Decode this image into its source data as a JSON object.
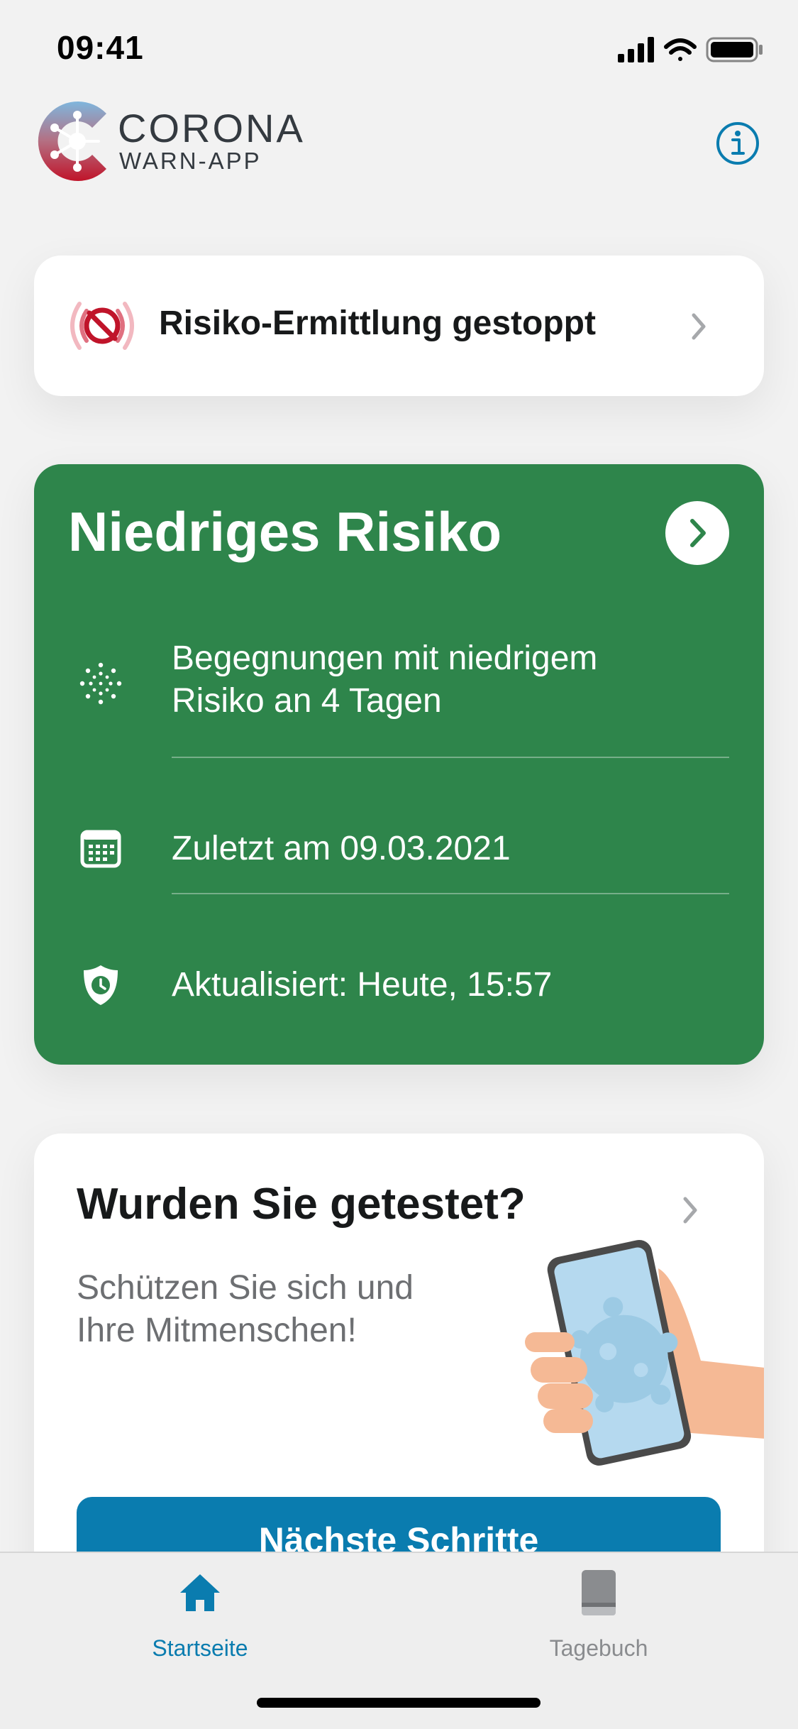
{
  "status_bar": {
    "time": "09:41"
  },
  "app": {
    "logo_title": "CORONA",
    "logo_subtitle": "WARN-APP"
  },
  "risk_stopped": {
    "title": "Risiko-Ermittlung gestoppt"
  },
  "risk_card": {
    "title": "Niedriges Risiko",
    "color": "#2e854b",
    "rows": [
      {
        "icon": "virus-dots-icon",
        "text_line1": "Begegnungen mit niedrigem",
        "text_line2": "Risiko an 4 Tagen"
      },
      {
        "icon": "calendar-icon",
        "text": "Zuletzt am 09.03.2021"
      },
      {
        "icon": "shield-clock-icon",
        "text": "Aktualisiert: Heute, 15:57"
      }
    ]
  },
  "test_card": {
    "title": "Wurden Sie getestet?",
    "subtitle_line1": "Schützen Sie sich und",
    "subtitle_line2": "Ihre Mitmenschen!",
    "button_label": "Nächste Schritte"
  },
  "tab_bar": {
    "tabs": [
      {
        "label": "Startseite",
        "icon": "home-icon",
        "active": true
      },
      {
        "label": "Tagebuch",
        "icon": "book-icon",
        "active": false
      }
    ],
    "active_color": "#0a7caf",
    "inactive_color": "#8a8c8f"
  }
}
